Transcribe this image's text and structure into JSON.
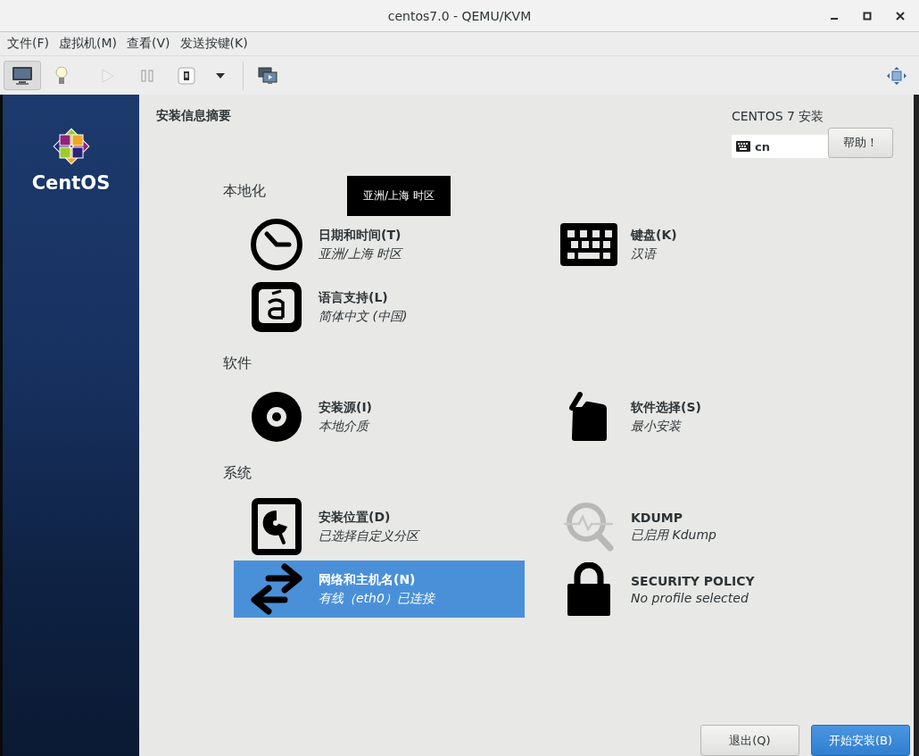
{
  "window": {
    "title": "centos7.0 - QEMU/KVM"
  },
  "menu": [
    "文件(F)",
    "虚拟机(M)",
    "查看(V)",
    "发送按键(K)"
  ],
  "toolbar": [
    {
      "selected": true,
      "disabled": false
    },
    {
      "selected": false,
      "disabled": false
    },
    {
      "selected": false,
      "disabled": true
    },
    {
      "selected": false,
      "disabled": false
    },
    {
      "selected": false,
      "disabled": false
    }
  ],
  "sidebar": {
    "logo_text": "CentOS"
  },
  "header": {
    "title": "安装信息摘要",
    "product": "CENTOS 7 安装",
    "keyboard_layout": "cn",
    "help_button": "帮助！"
  },
  "tooltip": "亚洲/上海 时区",
  "sections": [
    {
      "heading": "本地化",
      "items": [
        {
          "title": "日期和时间(T)",
          "status": "亚洲/上海 时区",
          "selected": false
        },
        {
          "title": "键盘(K)",
          "status": "汉语",
          "selected": false
        },
        {
          "title": "语言支持(L)",
          "status": "简体中文 (中国)",
          "selected": false
        }
      ]
    },
    {
      "heading": "软件",
      "items": [
        {
          "title": "安装源(I)",
          "status": "本地介质",
          "selected": false
        },
        {
          "title": "软件选择(S)",
          "status": "最小安装",
          "selected": false
        }
      ]
    },
    {
      "heading": "系统",
      "items": [
        {
          "title": "安装位置(D)",
          "status": "已选择自定义分区",
          "selected": false
        },
        {
          "title": "KDUMP",
          "status": "已启用 Kdump",
          "selected": false
        },
        {
          "title": "网络和主机名(N)",
          "status": "有线（eth0）已连接",
          "selected": true
        },
        {
          "title": "SECURITY POLICY",
          "status": "No profile selected",
          "selected": false
        }
      ]
    }
  ],
  "footer": {
    "buttons": [
      {
        "label": "退出(Q)",
        "kind": "secondary"
      },
      {
        "label": "开始安装(B)",
        "kind": "primary"
      }
    ]
  }
}
